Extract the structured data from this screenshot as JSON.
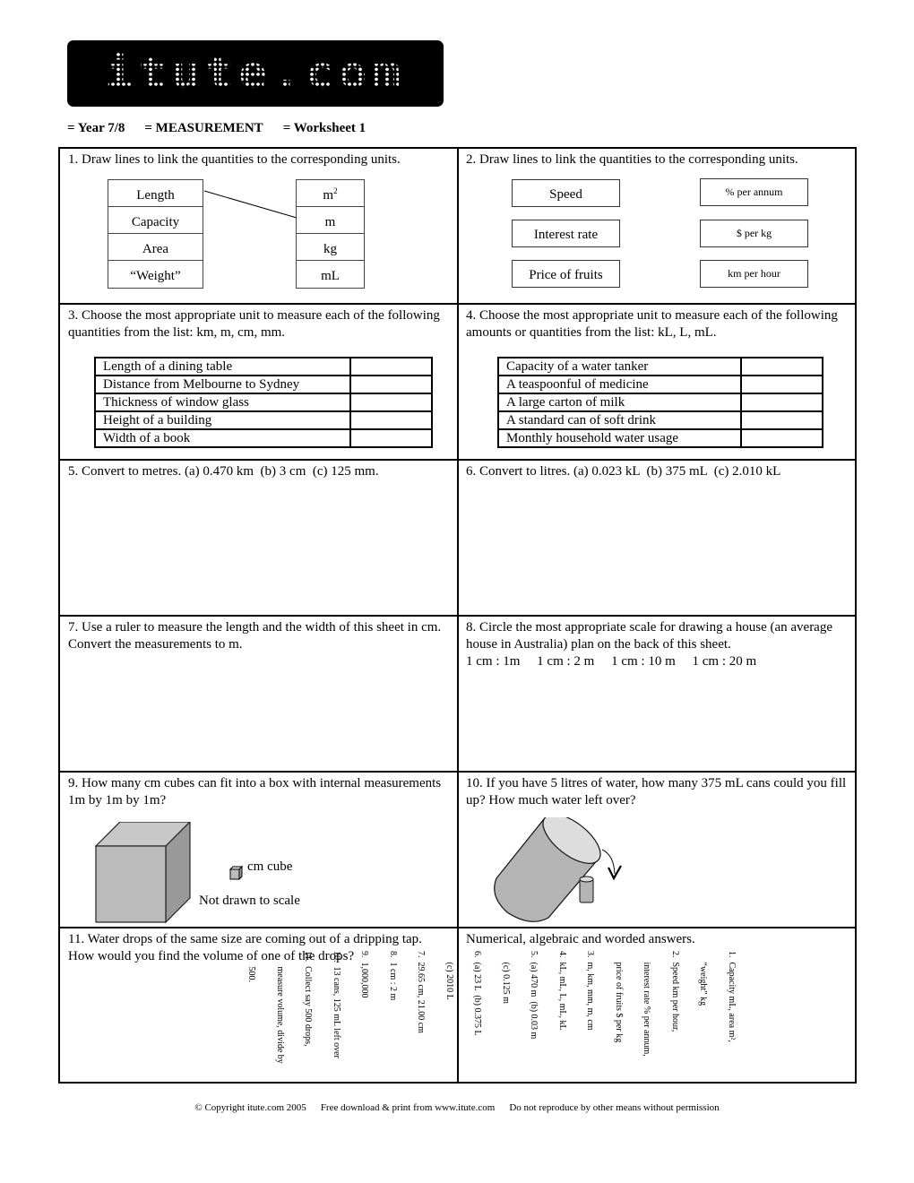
{
  "logo": {
    "text": "itute.com"
  },
  "subtitle": {
    "year": "= Year 7/8",
    "topic": "= MEASUREMENT",
    "worksheet": "= Worksheet 1"
  },
  "q1": {
    "prompt": "1. Draw lines to link the quantities to the corresponding units.",
    "quantities": [
      "Length",
      "Capacity",
      "Area",
      "“Weight”"
    ],
    "units": [
      "m",
      "m",
      "kg",
      "mL"
    ],
    "unit_superscripts": [
      "2",
      "",
      "",
      ""
    ]
  },
  "q2": {
    "prompt": "2. Draw lines to link the quantities to the corresponding units.",
    "quantities": [
      "Speed",
      "Interest rate",
      "Price of fruits"
    ],
    "units": [
      "% per annum",
      "$ per kg",
      "km per hour"
    ]
  },
  "q3": {
    "prompt": "3. Choose the most appropriate unit to measure each of the following quantities from the list: km, m, cm, mm.",
    "rows": [
      "Length of a dining table",
      "Distance from Melbourne to Sydney",
      "Thickness of window glass",
      "Height of a building",
      "Width of a book"
    ]
  },
  "q4": {
    "prompt": "4. Choose the most appropriate unit to measure each of the following amounts or quantities from the list: kL, L, mL.",
    "rows": [
      "Capacity of a water tanker",
      "A teaspoonful of medicine",
      "A large carton of milk",
      "A standard can of soft drink",
      "Monthly household water usage"
    ]
  },
  "q5": {
    "prompt": "5. Convert to metres. (a) 0.470 km  (b) 3 cm  (c) 125 mm."
  },
  "q6": {
    "prompt": "6. Convert to litres. (a) 0.023 kL  (b) 375 mL  (c) 2.010 kL"
  },
  "q7": {
    "prompt": "7. Use a ruler to measure the length and the width of this sheet in cm. Convert the measurements to m."
  },
  "q8": {
    "prompt": "8. Circle the most appropriate scale for drawing a house (an average house in Australia) plan on the back of this sheet.",
    "scales": [
      "1 cm : 1m",
      "1 cm : 2 m",
      "1 cm : 10 m",
      "1 cm : 20 m"
    ]
  },
  "q9": {
    "prompt": "9. How many cm cubes can fit into a box with internal measurements 1m by 1m by 1m?",
    "cube_label": "cm cube",
    "note": "Not drawn to scale"
  },
  "q10": {
    "prompt": "10. If you have 5 litres of water, how many 375 mL cans could you fill up? How much water left over?"
  },
  "q11": {
    "prompt": "11. Water drops of the same size are coming out of a dripping tap. How would you find the volume of one of the drops?"
  },
  "answers": {
    "heading": "Numerical, algebraic and worded answers.",
    "lines": [
      "1.  Capacity mL, area m²,",
      "     “weight” kg",
      "2.  Speed km per hour,",
      "     interest rate % per annum,",
      "     price of fruits $ per kg",
      "3.  m, km, mm, m, cm",
      "4.  kL, mL, L, mL, kL",
      "5.  (a) 470 m  (b) 0.03 m",
      "     (c) 0.125 m",
      "6.  (a) 23 L  (b) 0.375 L",
      "     (c) 2010 L",
      "7.  29.65 cm, 21.00 cm",
      "8.  1 cm : 2 m",
      "9.  1,000,000",
      "10.  13 cans, 125 mL left over",
      "11.  Collect say 500 drops,",
      "       measure volume, divide by",
      "       500."
    ]
  },
  "footer": {
    "copyright": "© Copyright itute.com 2005",
    "download": "Free download & print from www.itute.com",
    "notice": "Do not reproduce by other means without permission"
  }
}
